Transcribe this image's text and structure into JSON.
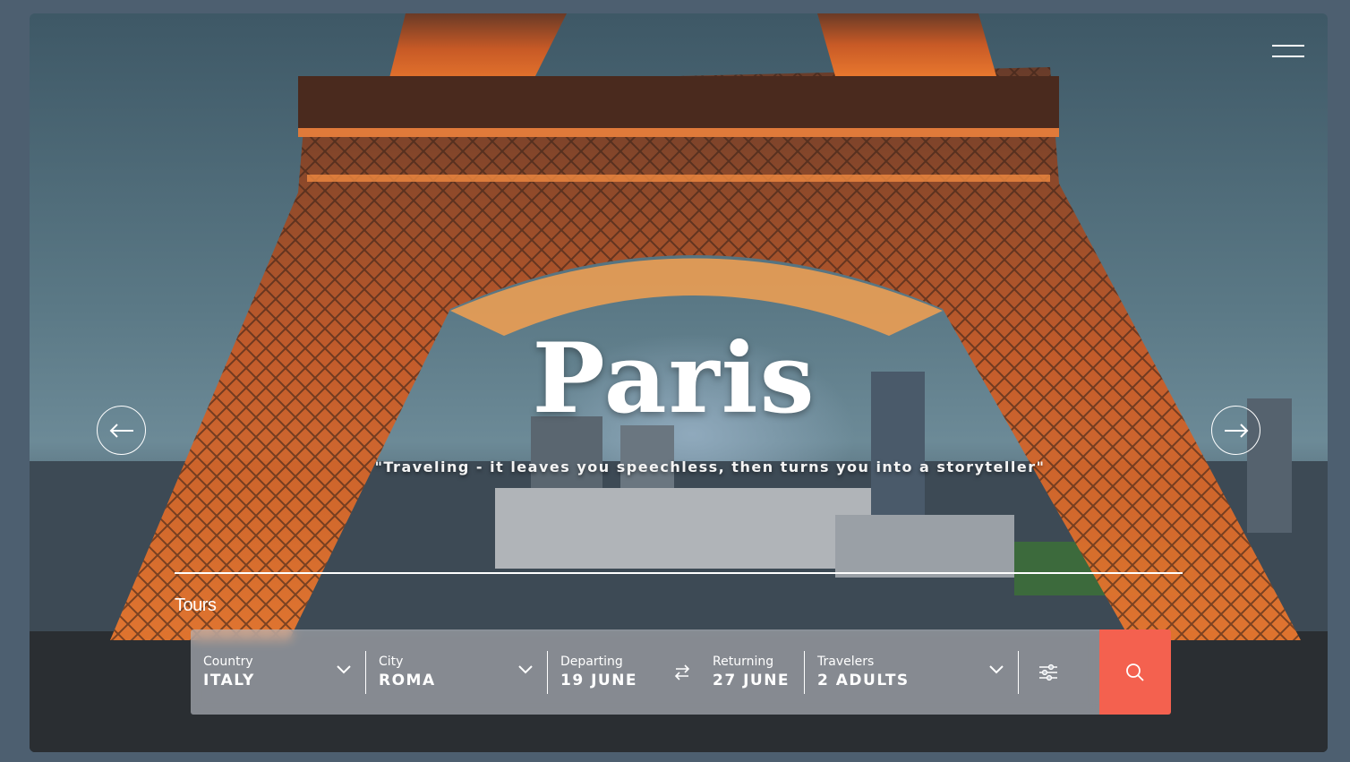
{
  "hero": {
    "title": "Paris",
    "tagline": "\"Traveling - it leaves you speechless, then turns you into a storyteller\""
  },
  "navigation": {
    "menu_icon": "hamburger-icon",
    "prev_icon": "arrow-left-icon",
    "next_icon": "arrow-right-icon"
  },
  "tabs": {
    "active": "Tours"
  },
  "search": {
    "country": {
      "label": "Country",
      "value": "ITALY"
    },
    "city": {
      "label": "City",
      "value": "ROMA"
    },
    "departing": {
      "label": "Departing",
      "value": "19 JUNE"
    },
    "returning": {
      "label": "Returning",
      "value": "27 JUNE"
    },
    "travelers": {
      "label": "Travelers",
      "value": "2 ADULTS"
    },
    "filter_icon": "sliders-icon",
    "search_icon": "search-icon"
  },
  "colors": {
    "accent": "#f4614f",
    "background": "#4d5f70"
  }
}
